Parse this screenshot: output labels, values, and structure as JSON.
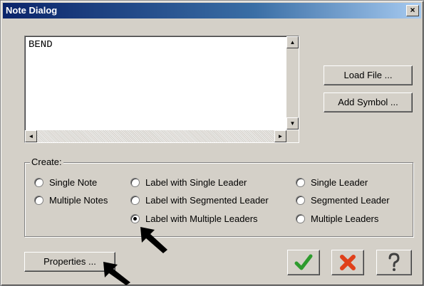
{
  "window": {
    "title": "Note Dialog",
    "close_label": "×"
  },
  "editor": {
    "text": "BEND",
    "scroll_up": "▲",
    "scroll_down": "▼",
    "scroll_left": "◄",
    "scroll_right": "►"
  },
  "side_buttons": {
    "load_file": "Load File ...",
    "add_symbol": "Add Symbol ..."
  },
  "create_group": {
    "label": "Create:",
    "options": [
      {
        "label": "Single Note",
        "selected": false
      },
      {
        "label": "Multiple Notes",
        "selected": false
      },
      {
        "label": "Label with Single Leader",
        "selected": false
      },
      {
        "label": "Label with Segmented Leader",
        "selected": false
      },
      {
        "label": "Label with Multiple Leaders",
        "selected": true
      },
      {
        "label": "Single Leader",
        "selected": false
      },
      {
        "label": "Segmented Leader",
        "selected": false
      },
      {
        "label": "Multiple Leaders",
        "selected": false
      }
    ]
  },
  "bottom": {
    "properties": "Properties ..."
  },
  "icons": {
    "ok": "check-icon",
    "cancel": "x-icon",
    "help": "question-icon",
    "pointer": "arrow-pointer-icon"
  },
  "colors": {
    "title_bar": "#0a246a",
    "ok": "#2e9b2e",
    "cancel": "#e0401a"
  }
}
